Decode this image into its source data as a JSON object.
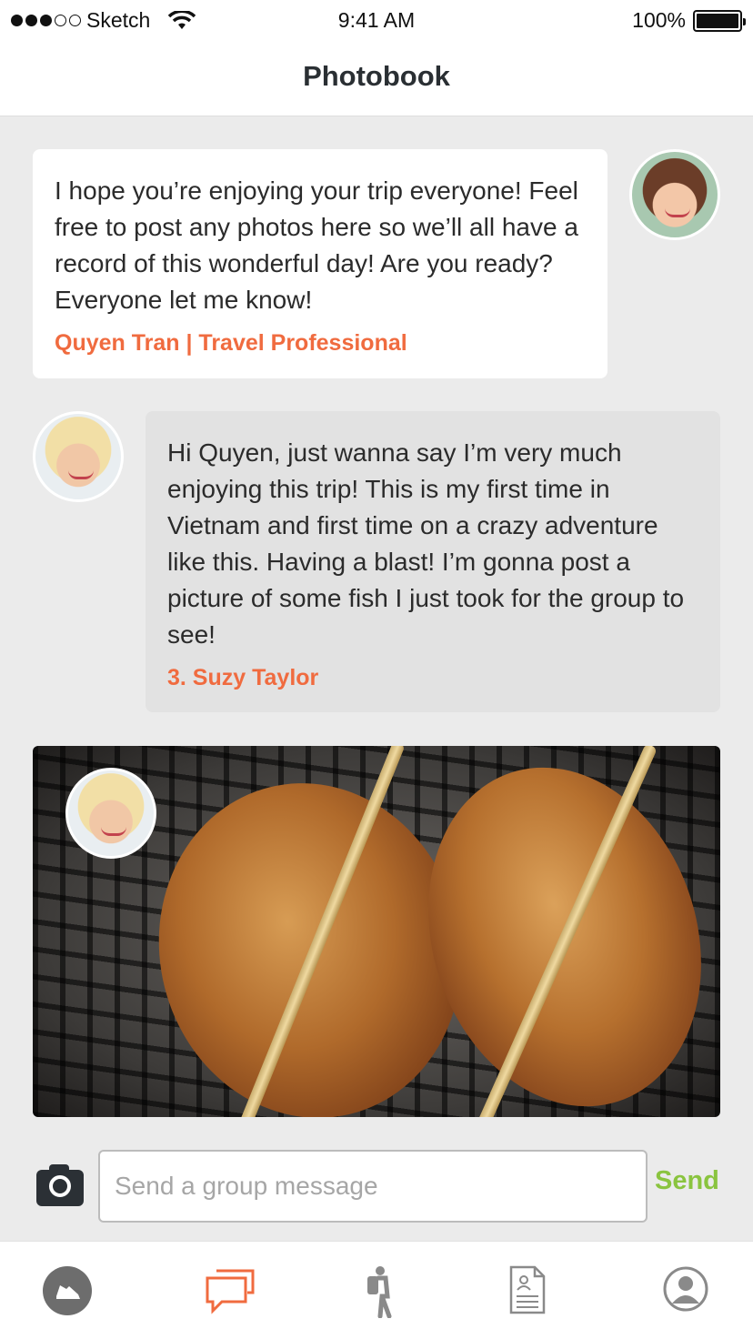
{
  "status_bar": {
    "carrier": "Sketch",
    "time": "9:41 AM",
    "battery": "100%"
  },
  "header": {
    "title": "Photobook"
  },
  "messages": [
    {
      "text": "I hope you’re enjoying your trip everyone! Feel free to post any photos here so we’ll all have a record of this wonderful day! Are you ready? Everyone let me know!",
      "author": "Quyen Tran  |  Travel Professional"
    },
    {
      "text": "Hi Quyen, just wanna say I’m very much enjoying this trip! This is my first time in Vietnam and first time on a crazy adventure like this. Having a blast! I’m gonna post a picture of some fish I just took for the group to see!",
      "author": "3. Suzy Taylor"
    }
  ],
  "composer": {
    "placeholder": "Send a group message",
    "send_label": "Send"
  },
  "tabs": [
    {
      "icon": "shoe-icon"
    },
    {
      "icon": "chat-icon",
      "active": true
    },
    {
      "icon": "hiker-icon"
    },
    {
      "icon": "document-icon"
    },
    {
      "icon": "profile-icon"
    }
  ],
  "colors": {
    "accent": "#f06b3f",
    "send": "#8ac43f",
    "background": "#ebebeb"
  }
}
